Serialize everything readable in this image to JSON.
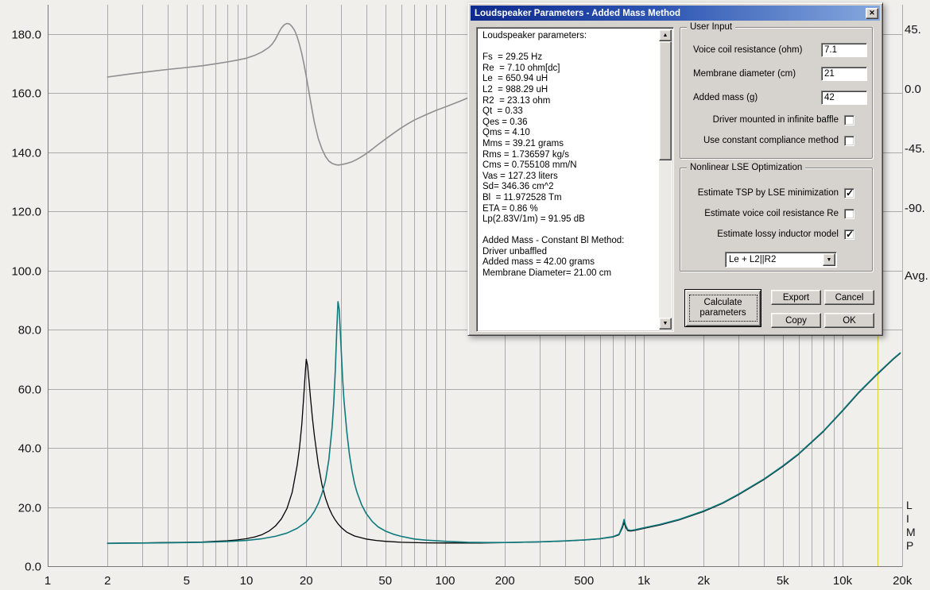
{
  "icons": {
    "close": "✕",
    "scroll_up": "▲",
    "scroll_down": "▼",
    "dropdown_arrow": "▼"
  },
  "chart_data": {
    "type": "line",
    "title": "",
    "x_axis": {
      "scale": "log",
      "min": 1,
      "max": 20000,
      "ticks": [
        {
          "f": 1,
          "label": "1"
        },
        {
          "f": 2,
          "label": "2"
        },
        {
          "f": 5,
          "label": "5"
        },
        {
          "f": 10,
          "label": "10"
        },
        {
          "f": 20,
          "label": "20"
        },
        {
          "f": 50,
          "label": "50"
        },
        {
          "f": 100,
          "label": "100"
        },
        {
          "f": 200,
          "label": "200"
        },
        {
          "f": 500,
          "label": "500"
        },
        {
          "f": 1000,
          "label": "1k"
        },
        {
          "f": 2000,
          "label": "2k"
        },
        {
          "f": 5000,
          "label": "5k"
        },
        {
          "f": 10000,
          "label": "10k"
        },
        {
          "f": 20000,
          "label": "20k"
        }
      ]
    },
    "y_left": {
      "min": 0,
      "max": 188,
      "ticks": [
        {
          "v": 0,
          "label": "0.0"
        },
        {
          "v": 20,
          "label": "20.0"
        },
        {
          "v": 40,
          "label": "40.0"
        },
        {
          "v": 60,
          "label": "60.0"
        },
        {
          "v": 80,
          "label": "80.0"
        },
        {
          "v": 100,
          "label": "100.0"
        },
        {
          "v": 120,
          "label": "120.0"
        },
        {
          "v": 140,
          "label": "140.0"
        },
        {
          "v": 160,
          "label": "160.0"
        },
        {
          "v": 180,
          "label": "180.0"
        }
      ]
    },
    "y_right": {
      "phase_ticks": [
        {
          "deg": 45,
          "label": "45."
        },
        {
          "deg": 0,
          "label": "0.0"
        },
        {
          "deg": -45,
          "label": "-45."
        },
        {
          "deg": -90,
          "label": "-90."
        }
      ],
      "avg_label": "Avg.",
      "vertical_label": "LIMP"
    },
    "cursor": {
      "f": 15000
    },
    "colors": {
      "background": "#f0efec",
      "grid": "#aaaaaa",
      "axis": "#777777",
      "cursor": "#d9cb3a",
      "phase": "#8f8f8f",
      "impedance_added_mass": "#000000",
      "impedance_free_air": "#0f7a7e"
    },
    "series": [
      {
        "name": "phase",
        "axis": "phase",
        "color": "#8f8f8f",
        "width": 1.6,
        "points": [
          [
            2,
            9
          ],
          [
            2.5,
            11
          ],
          [
            3,
            12.5
          ],
          [
            3.5,
            13.7
          ],
          [
            4,
            14.7
          ],
          [
            5,
            16.2
          ],
          [
            6,
            17.5
          ],
          [
            7,
            19
          ],
          [
            8,
            20.4
          ],
          [
            9,
            21.8
          ],
          [
            10,
            23.2
          ],
          [
            11,
            25.3
          ],
          [
            12,
            28
          ],
          [
            13,
            31.5
          ],
          [
            13.5,
            34
          ],
          [
            14,
            37.5
          ],
          [
            14.5,
            42
          ],
          [
            15,
            46
          ],
          [
            15.5,
            48.5
          ],
          [
            16,
            49.5
          ],
          [
            16.5,
            49
          ],
          [
            17,
            47
          ],
          [
            17.5,
            44
          ],
          [
            18,
            39.5
          ],
          [
            18.5,
            33.5
          ],
          [
            19,
            26.5
          ],
          [
            19.5,
            18.5
          ],
          [
            20,
            9.5
          ],
          [
            20.5,
            0.5
          ],
          [
            21,
            -9
          ],
          [
            21.5,
            -17.5
          ],
          [
            22,
            -25.5
          ],
          [
            23,
            -37.5
          ],
          [
            24,
            -45.5
          ],
          [
            25,
            -51
          ],
          [
            26,
            -54.5
          ],
          [
            27,
            -56.3
          ],
          [
            28,
            -57.2
          ],
          [
            29,
            -57.5
          ],
          [
            30,
            -57.2
          ],
          [
            32,
            -56.3
          ],
          [
            34,
            -55
          ],
          [
            36,
            -53.2
          ],
          [
            38,
            -51.2
          ],
          [
            40,
            -49
          ],
          [
            43,
            -45.5
          ],
          [
            46,
            -42
          ],
          [
            50,
            -38
          ],
          [
            55,
            -33.5
          ],
          [
            60,
            -29.5
          ],
          [
            65,
            -26.3
          ],
          [
            70,
            -23.5
          ],
          [
            80,
            -19.5
          ],
          [
            90,
            -16.2
          ],
          [
            100,
            -13.6
          ],
          [
            110,
            -11.2
          ],
          [
            120,
            -9
          ],
          [
            130,
            -6.8
          ]
        ]
      },
      {
        "name": "impedance-added-mass",
        "axis": "left",
        "color": "#000000",
        "width": 1.3,
        "points": [
          [
            2,
            7.8
          ],
          [
            3,
            7.9
          ],
          [
            4,
            8
          ],
          [
            5,
            8.1
          ],
          [
            6,
            8.2
          ],
          [
            7,
            8.4
          ],
          [
            8,
            8.6
          ],
          [
            9,
            8.9
          ],
          [
            10,
            9.3
          ],
          [
            11,
            9.9
          ],
          [
            12,
            10.7
          ],
          [
            13,
            11.9
          ],
          [
            14,
            13.6
          ],
          [
            15,
            16
          ],
          [
            16,
            19.5
          ],
          [
            17,
            25
          ],
          [
            18,
            34
          ],
          [
            18.5,
            40
          ],
          [
            19,
            48
          ],
          [
            19.5,
            59
          ],
          [
            19.8,
            66
          ],
          [
            20,
            70
          ],
          [
            20.3,
            68
          ],
          [
            20.7,
            62
          ],
          [
            21,
            57
          ],
          [
            21.5,
            50
          ],
          [
            22,
            44
          ],
          [
            23,
            34.5
          ],
          [
            24,
            27.5
          ],
          [
            25,
            23
          ],
          [
            26,
            19.8
          ],
          [
            27,
            17.4
          ],
          [
            28,
            15.6
          ],
          [
            29,
            14.2
          ],
          [
            30,
            13.1
          ],
          [
            32,
            11.5
          ],
          [
            35,
            10.2
          ],
          [
            40,
            9.2
          ],
          [
            45,
            8.7
          ],
          [
            50,
            8.4
          ],
          [
            60,
            8.1
          ],
          [
            80,
            7.9
          ],
          [
            100,
            7.85
          ],
          [
            150,
            7.85
          ],
          [
            200,
            7.95
          ],
          [
            300,
            8.2
          ],
          [
            400,
            8.5
          ],
          [
            500,
            8.85
          ],
          [
            600,
            9.25
          ],
          [
            700,
            9.9
          ],
          [
            750,
            10.6
          ],
          [
            780,
            13
          ],
          [
            795,
            14.8
          ],
          [
            810,
            13.2
          ],
          [
            830,
            12
          ],
          [
            860,
            11.9
          ],
          [
            900,
            12.1
          ],
          [
            1000,
            12.8
          ],
          [
            1200,
            13.9
          ],
          [
            1500,
            15.6
          ],
          [
            2000,
            18.5
          ],
          [
            2500,
            21.3
          ],
          [
            3000,
            24.2
          ],
          [
            4000,
            29.2
          ],
          [
            5000,
            33.7
          ],
          [
            6000,
            37.8
          ],
          [
            8000,
            45.5
          ],
          [
            10000,
            52.5
          ],
          [
            12000,
            58.5
          ],
          [
            15000,
            65
          ],
          [
            18000,
            70
          ],
          [
            19500,
            72
          ]
        ]
      },
      {
        "name": "impedance-free-air",
        "axis": "left",
        "color": "#0f7a7e",
        "width": 1.6,
        "points": [
          [
            2,
            7.7
          ],
          [
            4,
            7.9
          ],
          [
            6,
            8.1
          ],
          [
            8,
            8.35
          ],
          [
            10,
            8.7
          ],
          [
            12,
            9.3
          ],
          [
            14,
            10.1
          ],
          [
            16,
            11.2
          ],
          [
            18,
            12.8
          ],
          [
            20,
            15
          ],
          [
            21,
            16.6
          ],
          [
            22,
            18.6
          ],
          [
            23,
            21.2
          ],
          [
            24,
            24.6
          ],
          [
            25,
            29
          ],
          [
            26,
            36
          ],
          [
            27,
            47
          ],
          [
            27.5,
            55
          ],
          [
            28,
            66
          ],
          [
            28.5,
            80
          ],
          [
            28.9,
            89.5
          ],
          [
            29.3,
            87
          ],
          [
            29.7,
            79
          ],
          [
            30,
            73
          ],
          [
            30.5,
            63
          ],
          [
            31,
            56
          ],
          [
            32,
            45.5
          ],
          [
            33,
            37.8
          ],
          [
            34,
            32.2
          ],
          [
            35,
            28
          ],
          [
            36,
            25
          ],
          [
            38,
            20.8
          ],
          [
            40,
            17.9
          ],
          [
            43,
            15.1
          ],
          [
            46,
            13.3
          ],
          [
            50,
            11.9
          ],
          [
            55,
            10.8
          ],
          [
            60,
            10.1
          ],
          [
            70,
            9.2
          ],
          [
            80,
            8.8
          ],
          [
            100,
            8.4
          ],
          [
            130,
            8.1
          ],
          [
            160,
            8
          ],
          [
            200,
            8
          ],
          [
            300,
            8.25
          ],
          [
            400,
            8.55
          ],
          [
            500,
            8.9
          ],
          [
            600,
            9.3
          ],
          [
            700,
            10
          ],
          [
            750,
            10.8
          ],
          [
            780,
            13.6
          ],
          [
            795,
            15.8
          ],
          [
            810,
            13.8
          ],
          [
            830,
            12.3
          ],
          [
            860,
            12.1
          ],
          [
            900,
            12.3
          ],
          [
            1000,
            13
          ],
          [
            1200,
            14.1
          ],
          [
            1500,
            15.8
          ],
          [
            2000,
            18.7
          ],
          [
            2500,
            21.5
          ],
          [
            3000,
            24.4
          ],
          [
            4000,
            29.4
          ],
          [
            5000,
            33.9
          ],
          [
            6000,
            38
          ],
          [
            8000,
            45.7
          ],
          [
            10000,
            52.7
          ],
          [
            12000,
            58.7
          ],
          [
            15000,
            65.2
          ],
          [
            18000,
            70.2
          ],
          [
            19500,
            72.2
          ]
        ]
      }
    ]
  },
  "dialog": {
    "title": "Loudspeaker Parameters - Added Mass Method",
    "parameters_text": [
      "Loudspeaker parameters:",
      "",
      "Fs  = 29.25 Hz",
      "Re  = 7.10 ohm[dc]",
      "Le  = 650.94 uH",
      "L2  = 988.29 uH",
      "R2  = 23.13 ohm",
      "Qt  = 0.33",
      "Qes = 0.36",
      "Qms = 4.10",
      "Mms = 39.21 grams",
      "Rms = 1.736597 kg/s",
      "Cms = 0.755108 mm/N",
      "Vas = 127.23 liters",
      "Sd= 346.36 cm^2",
      "Bl  = 11.972528 Tm",
      "ETA = 0.86 %",
      "Lp(2.83V/1m) = 91.95 dB",
      "",
      "Added Mass - Constant Bl Method:",
      "Driver unbaffled",
      "Added mass = 42.00 grams",
      "Membrane Diameter= 21.00 cm"
    ],
    "user_input": {
      "legend": "User Input",
      "fields": [
        {
          "label": "Voice coil resistance (ohm)",
          "value": "7.1"
        },
        {
          "label": "Membrane diameter (cm)",
          "value": "21"
        },
        {
          "label": "Added mass (g)",
          "value": "42"
        }
      ],
      "checkboxes": [
        {
          "label": "Driver mounted in infinite baffle",
          "checked": false
        },
        {
          "label": "Use constant compliance method",
          "checked": false
        }
      ]
    },
    "nonlinear": {
      "legend": "Nonlinear LSE Optimization",
      "checkboxes": [
        {
          "label": "Estimate TSP by LSE minimization",
          "checked": true
        },
        {
          "label": "Estimate voice coil resistance Re",
          "checked": false
        },
        {
          "label": "Estimate lossy inductor model",
          "checked": true
        }
      ],
      "inductor_model": "Le + L2||R2"
    },
    "buttons": {
      "calculate": "Calculate parameters",
      "export": "Export",
      "cancel": "Cancel",
      "copy": "Copy",
      "ok": "OK"
    }
  }
}
